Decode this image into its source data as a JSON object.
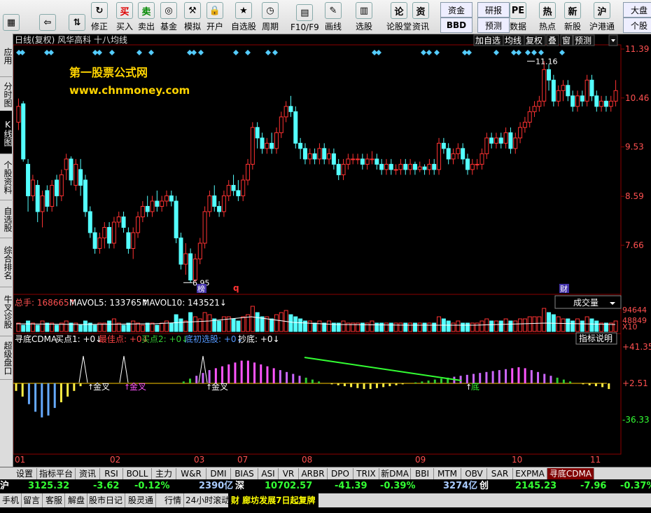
{
  "toolbar": {
    "items": [
      {
        "label": "",
        "icon": "home-icon"
      },
      {
        "label": "",
        "icon": "back-arrow-icon"
      },
      {
        "label": "",
        "icon": "up-down-arrows-icon"
      },
      {
        "label": "修正",
        "icon": "refresh-icon"
      },
      {
        "label": "买入",
        "icon": "buy-icon"
      },
      {
        "label": "卖出",
        "icon": "sell-icon"
      },
      {
        "label": "基金",
        "icon": "fund-icon"
      },
      {
        "label": "模拟",
        "icon": "hammer-icon"
      },
      {
        "label": "开户",
        "icon": "lock-icon"
      },
      {
        "label": "自选股",
        "icon": "star-icon"
      },
      {
        "label": "周期",
        "icon": "clock-icon"
      },
      {
        "label": "F10/F9",
        "icon": "f10-icon"
      },
      {
        "label": "画线",
        "icon": "pen-icon"
      },
      {
        "label": "选股",
        "icon": "select-stock-icon"
      },
      {
        "label": "论股堂",
        "icon": "forum-icon"
      },
      {
        "label": "资讯",
        "icon": "news-icon"
      },
      {
        "label": "资金",
        "icon": "fund-flow-icon"
      },
      {
        "label": "BBD",
        "icon": "bbd-icon"
      },
      {
        "label": "研报",
        "icon": "report-icon"
      },
      {
        "label": "预测",
        "icon": "forecast-icon"
      },
      {
        "label": "数据",
        "icon": "pe-data-icon"
      },
      {
        "label": "热点",
        "icon": "hot-icon"
      },
      {
        "label": "新股",
        "icon": "new-stock-icon"
      },
      {
        "label": "沪港通",
        "icon": "sse-hk-icon"
      },
      {
        "label": "大盘",
        "icon": "index-icon"
      },
      {
        "label": "个股",
        "icon": "stock-icon"
      }
    ]
  },
  "left_nav": [
    {
      "label": "应用"
    },
    {
      "label": "分时图"
    },
    {
      "label": "K线图",
      "active": true
    },
    {
      "label": "个股资料"
    },
    {
      "label": "自选股"
    },
    {
      "label": "综合排名"
    },
    {
      "label": "牛叉诊股"
    },
    {
      "label": "超级盘口"
    }
  ],
  "chart_header": {
    "title": "日线(复权)  风华高科  十八均线",
    "buttons": [
      "加自选",
      "均线",
      "复权",
      "叠",
      "窗",
      "预测"
    ],
    "watermark_line1": "第一股票公式网",
    "watermark_line2": "www.chnmoney.com"
  },
  "price_axis": [
    "11.39",
    "10.46",
    "9.53",
    "8.59",
    "7.66"
  ],
  "markers": {
    "high_label": "11.16",
    "low_label": "6.95",
    "bang": "榜",
    "q": "q",
    "cai": "财"
  },
  "volume_panel": {
    "total_label": "总手: 168665↑",
    "mavol5_label": "MAVOL5: 133765↑",
    "mavol10_label": "MAVOL10: 143521↓",
    "dropdown": "成交量",
    "axis": [
      "94644",
      "48849",
      "X10"
    ]
  },
  "indicator_panel": {
    "name": "寻底CDMA",
    "buy1": "买点1: +0↓",
    "best": "最佳点: +0↓",
    "buy2": "买点2: +0↓",
    "bottom_select": "底初选股: +0↓",
    "chaodi": "抄底: +0↓",
    "explain_button": "指标说明",
    "axis": [
      "+41.35",
      "+2.51",
      "-36.33"
    ],
    "labels": [
      "金叉",
      "金叉",
      "金叉",
      "底"
    ]
  },
  "time_axis": [
    "01",
    "02",
    "03",
    "07",
    "08",
    "09",
    "10",
    "11"
  ],
  "bottom_tabs": [
    "设置",
    "指标平台",
    "资讯",
    "RSI",
    "BOLL",
    "主力",
    "W&R",
    "DMI",
    "BIAS",
    "ASI",
    "VR",
    "ARBR",
    "DPO",
    "TRIX",
    "新DMA",
    "BBI",
    "MTM",
    "OBV",
    "SAR",
    "EXPMA",
    "寻底CDMA"
  ],
  "ticker": {
    "sh_label": "沪",
    "sh_index": "3125.32",
    "sh_change": "-3.62",
    "sh_pct": "-0.12%",
    "sh_amount": "2390亿",
    "sz_label": "深",
    "sz_index": "10702.57",
    "sz_change": "-41.39",
    "sz_pct": "-0.39%",
    "sz_amount": "3274亿",
    "cy_label": "创",
    "cy_index": "2145.23",
    "cy_change": "-7.96",
    "cy_pct": "-0.37%"
  },
  "status_bar": [
    "手机",
    "留言",
    "客服",
    "解盘",
    "股市日记",
    "股灵通",
    "行情",
    "24小时滚动"
  ],
  "news_headline": "财 廊坊发展7日起复牌",
  "colors": {
    "up": "#ff3232",
    "down": "#54ffff",
    "grid": "#8b0000",
    "axis_text": "#ff5050",
    "yellow": "#ffff00",
    "magenta": "#ff55ff",
    "green": "#33ff33",
    "blue": "#5599ff"
  }
}
